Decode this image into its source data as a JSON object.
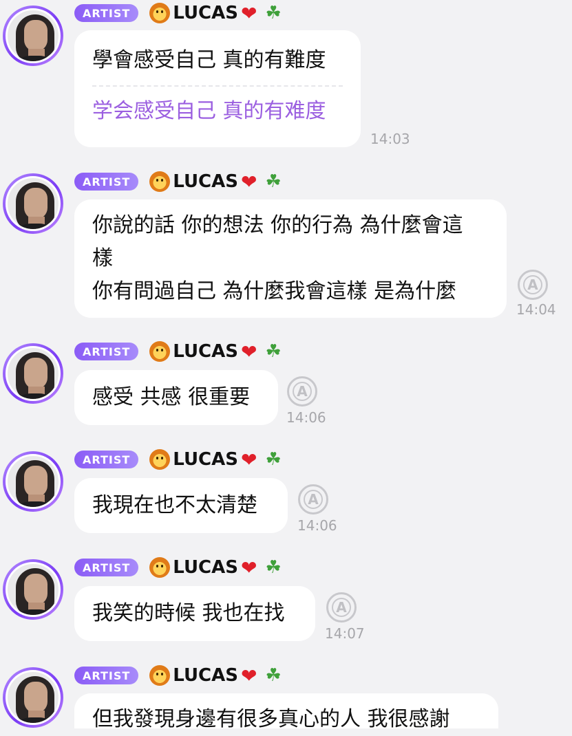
{
  "messages": [
    {
      "badge": "ARTIST",
      "name": "LUCAS",
      "lines": [
        "學會感受自己 真的有難度"
      ],
      "translation": [
        "学会感受自己 真的有难度"
      ],
      "time": "14:03",
      "translate_icon": "translate-icon"
    },
    {
      "badge": "ARTIST",
      "name": "LUCAS",
      "lines": [
        "你說的話 你的想法 你的行為 為什麼會這",
        "樣",
        "你有問過自己 為什麼我會這樣 是為什麼"
      ],
      "time": "14:04",
      "translate_icon": "translate-icon"
    },
    {
      "badge": "ARTIST",
      "name": "LUCAS",
      "lines": [
        "感受 共感 很重要"
      ],
      "time": "14:06",
      "translate_icon": "translate-icon"
    },
    {
      "badge": "ARTIST",
      "name": "LUCAS",
      "lines": [
        "我現在也不太清楚"
      ],
      "time": "14:06",
      "translate_icon": "translate-icon"
    },
    {
      "badge": "ARTIST",
      "name": "LUCAS",
      "lines": [
        "我笑的時候 我也在找"
      ],
      "time": "14:07",
      "translate_icon": "translate-icon"
    },
    {
      "badge": "ARTIST",
      "name": "LUCAS",
      "lines": [
        "但我發現身邊有很多真心的人 我很感謝"
      ]
    }
  ],
  "colors": {
    "badge": "#8b5cf6",
    "translation_text": "#9b5fe0",
    "background": "#f2f2f4"
  },
  "icons": {
    "name_emoji_left": "lion-face-icon",
    "name_emoji_heart": "red-heart-icon",
    "name_emoji_clover": "four-leaf-clover-icon"
  }
}
